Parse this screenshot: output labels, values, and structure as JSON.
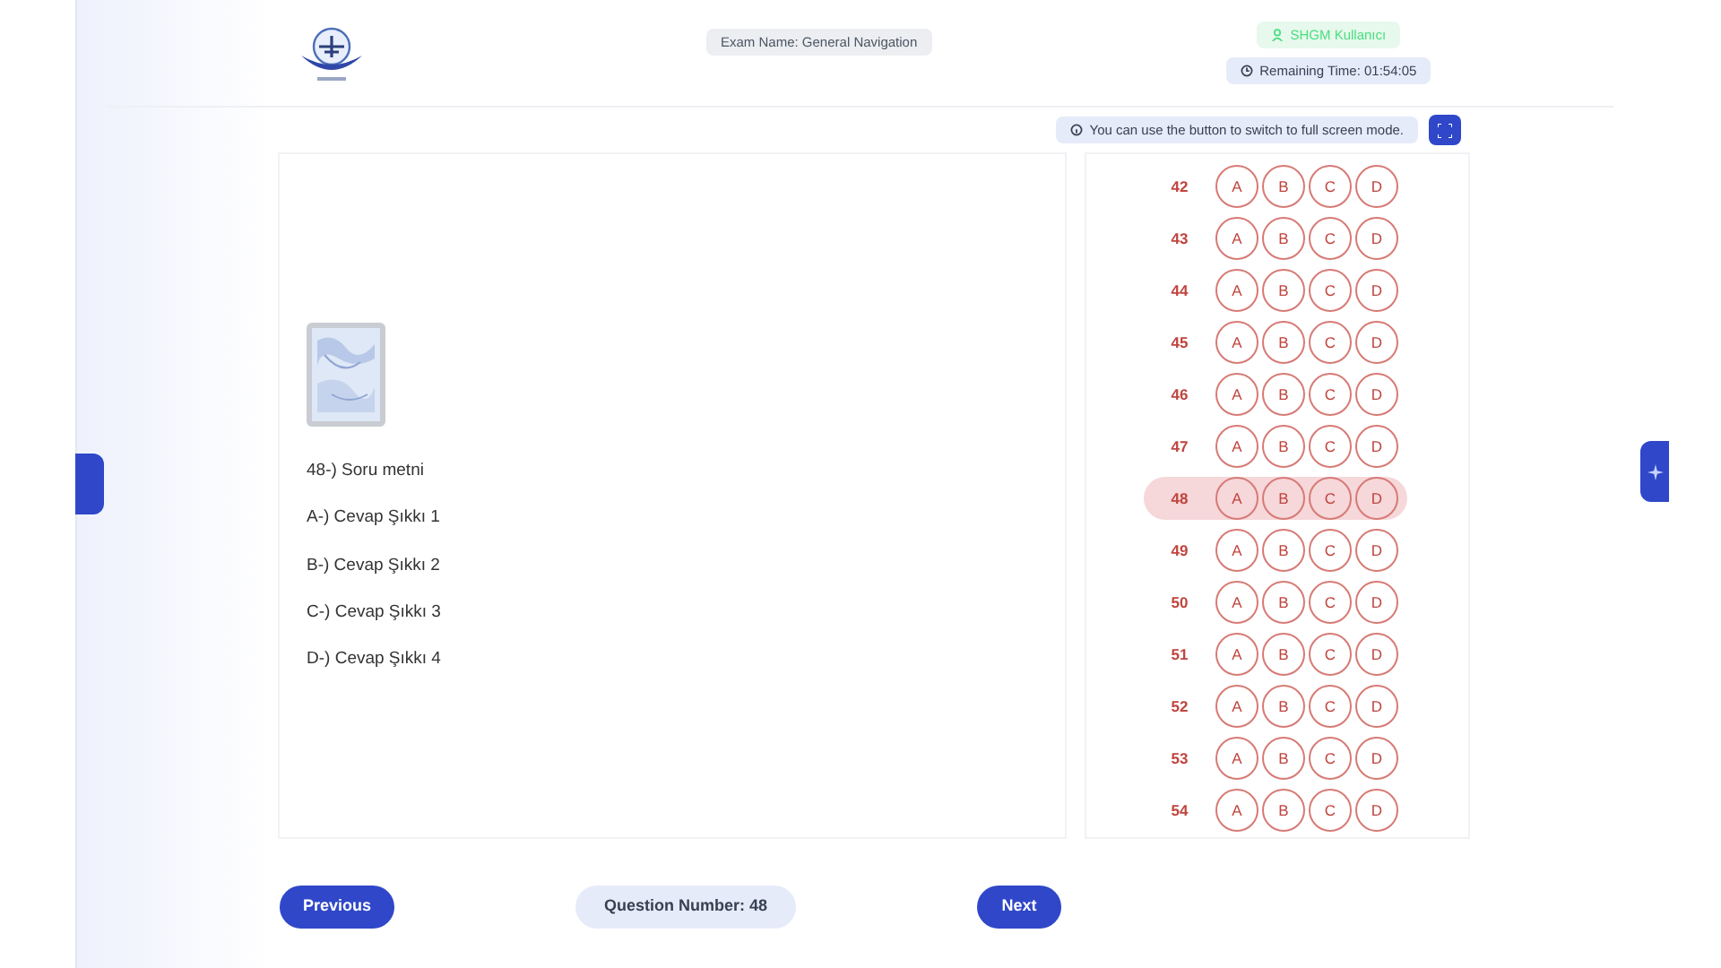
{
  "header": {
    "exam_name": "Exam Name: General Navigation",
    "user": "SHGM Kullanıcı",
    "remaining_time": "Remaining Time: 01:54:05"
  },
  "info": "You can use the button to switch to full screen mode.",
  "question": {
    "text": "48-) Soru metni",
    "options": [
      "A-) Cevap Şıkkı 1",
      "B-) Cevap Şıkkı 2",
      "C-) Cevap Şıkkı 3",
      "D-) Cevap Şıkkı 4"
    ]
  },
  "answer_sheet": [
    {
      "number": "42",
      "choices": [
        "A",
        "B",
        "C",
        "D"
      ],
      "selected": false
    },
    {
      "number": "43",
      "choices": [
        "A",
        "B",
        "C",
        "D"
      ],
      "selected": false
    },
    {
      "number": "44",
      "choices": [
        "A",
        "B",
        "C",
        "D"
      ],
      "selected": false
    },
    {
      "number": "45",
      "choices": [
        "A",
        "B",
        "C",
        "D"
      ],
      "selected": false
    },
    {
      "number": "46",
      "choices": [
        "A",
        "B",
        "C",
        "D"
      ],
      "selected": false
    },
    {
      "number": "47",
      "choices": [
        "A",
        "B",
        "C",
        "D"
      ],
      "selected": false
    },
    {
      "number": "48",
      "choices": [
        "A",
        "B",
        "C",
        "D"
      ],
      "selected": true
    },
    {
      "number": "49",
      "choices": [
        "A",
        "B",
        "C",
        "D"
      ],
      "selected": false
    },
    {
      "number": "50",
      "choices": [
        "A",
        "B",
        "C",
        "D"
      ],
      "selected": false
    },
    {
      "number": "51",
      "choices": [
        "A",
        "B",
        "C",
        "D"
      ],
      "selected": false
    },
    {
      "number": "52",
      "choices": [
        "A",
        "B",
        "C",
        "D"
      ],
      "selected": false
    },
    {
      "number": "53",
      "choices": [
        "A",
        "B",
        "C",
        "D"
      ],
      "selected": false
    },
    {
      "number": "54",
      "choices": [
        "A",
        "B",
        "C",
        "D"
      ],
      "selected": false
    }
  ],
  "footer": {
    "previous": "Previous",
    "question_number": "Question Number: 48",
    "next": "Next"
  }
}
